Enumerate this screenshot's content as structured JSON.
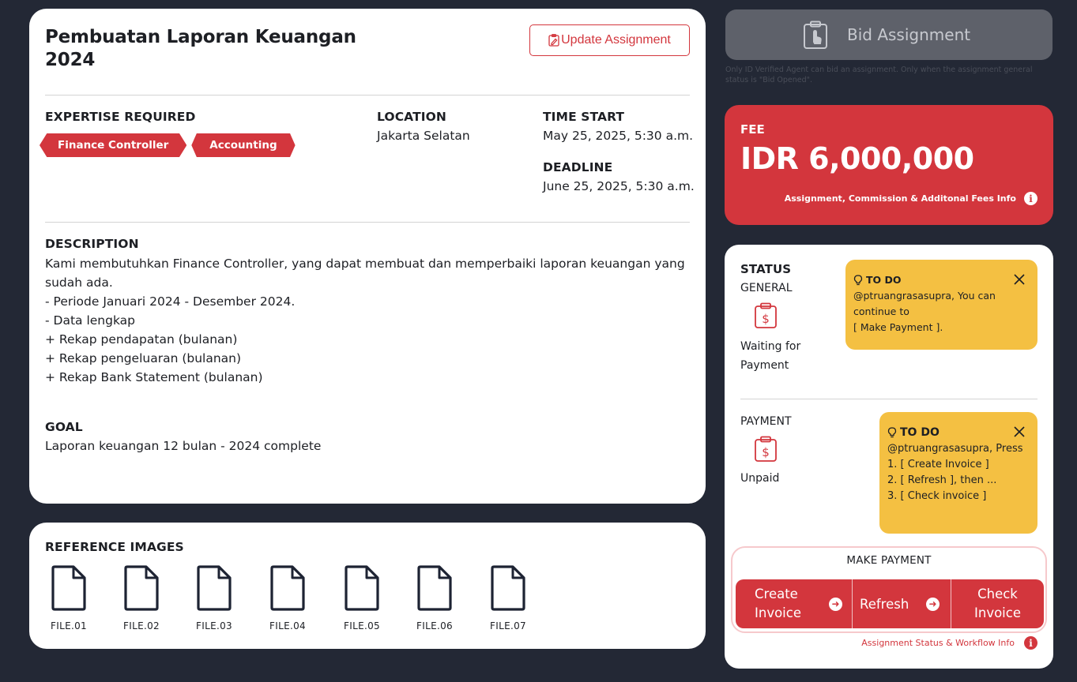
{
  "assignment": {
    "title": "Pembuatan Laporan Keuangan 2024",
    "update_label": "Update Assignment",
    "expertise_label": "EXPERTISE REQUIRED",
    "expertise": [
      "Finance Controller",
      "Accounting"
    ],
    "location_label": "LOCATION",
    "location": "Jakarta Selatan",
    "time_start_label": "TIME START",
    "time_start": "May 25, 2025, 5:30 a.m.",
    "deadline_label": "DEADLINE",
    "deadline": "June 25, 2025, 5:30 a.m.",
    "description_label": "DESCRIPTION",
    "description_lines": [
      "Kami membutuhkan Finance Controller, yang dapat membuat dan memperbaiki laporan keuangan yang sudah ada.",
      "- Periode Januari 2024 - Desember 2024.",
      "- Data lengkap",
      "+ Rekap pendapatan (bulanan)",
      "+ Rekap pengeluaran (bulanan)",
      "+ Rekap Bank Statement (bulanan)"
    ],
    "goal_label": "GOAL",
    "goal": "Laporan keuangan 12 bulan - 2024 complete"
  },
  "references": {
    "label": "REFERENCE IMAGES",
    "files": [
      "FILE.01",
      "FILE.02",
      "FILE.03",
      "FILE.04",
      "FILE.05",
      "FILE.06",
      "FILE.07"
    ]
  },
  "bid": {
    "label": "Bid Assignment",
    "note": "Only ID Verified Agent can bid an assignment. Only when the assignment general status is \"Bid Opened\"."
  },
  "fee": {
    "label": "FEE",
    "value": "IDR 6,000,000",
    "info": "Assignment, Commission & Additonal Fees Info"
  },
  "status": {
    "label": "STATUS",
    "general_label": "GENERAL",
    "general_value": "Waiting for Payment",
    "general_todo": {
      "title": "TO DO",
      "lines": [
        "@ptruangrasasupra, You can continue to",
        "[ Make Payment ]."
      ]
    },
    "payment_label": "PAYMENT",
    "payment_value": "Unpaid",
    "payment_todo": {
      "title": "TO DO",
      "lines": [
        "@ptruangrasasupra, Press",
        "1. [ Create Invoice ]",
        "2. [ Refresh ], then ...",
        "3. [ Check invoice ]"
      ]
    }
  },
  "make_payment": {
    "title": "MAKE PAYMENT",
    "create_invoice": "Create Invoice",
    "refresh": "Refresh",
    "check_invoice": "Check Invoice"
  },
  "workflow_info": "Assignment Status & Workflow Info",
  "colors": {
    "accent": "#d3363d",
    "todo": "#f4c042",
    "background": "#232835"
  }
}
